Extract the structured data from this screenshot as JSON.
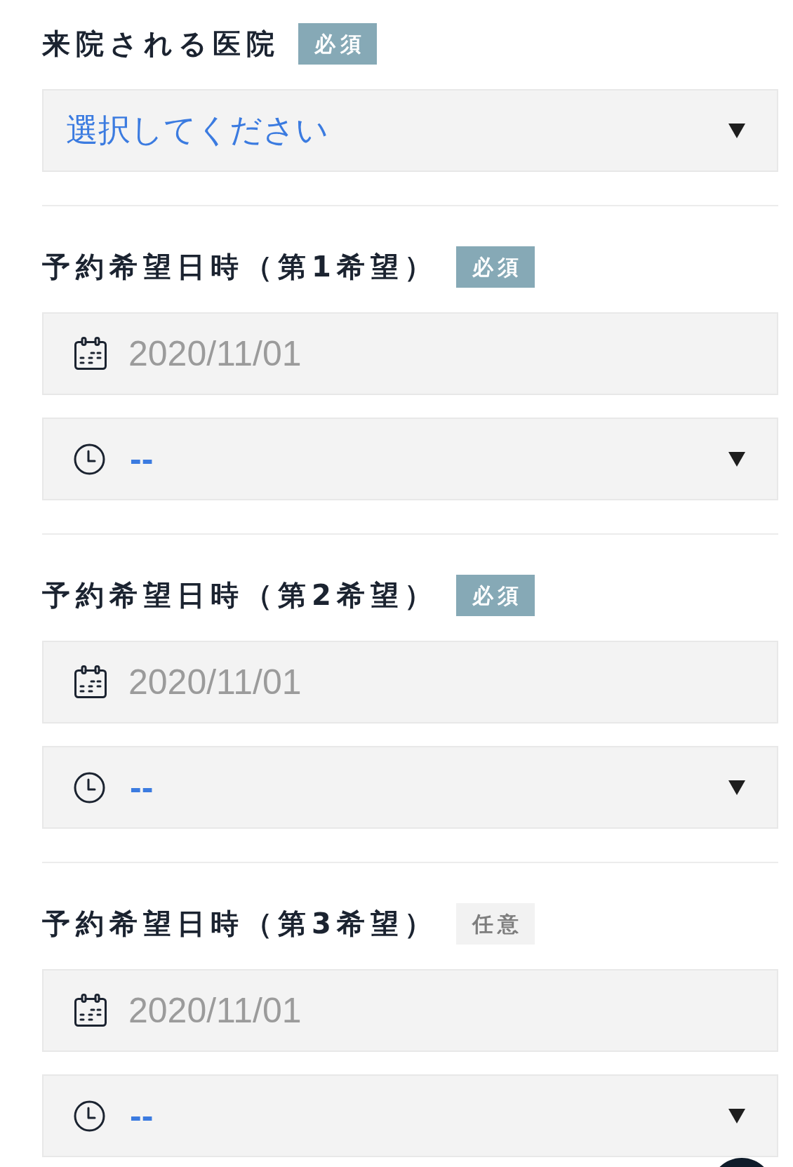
{
  "form": {
    "fields": [
      {
        "kind": "select",
        "label": "来院される医院",
        "badge": {
          "kind": "required",
          "text": "必須"
        },
        "select": {
          "value": "選択してください"
        }
      },
      {
        "kind": "datetime",
        "label": "予約希望日時（第1希望）",
        "badge": {
          "kind": "required",
          "text": "必須"
        },
        "date": {
          "placeholder": "2020/11/01"
        },
        "time": {
          "value": "--"
        }
      },
      {
        "kind": "datetime",
        "label": "予約希望日時（第2希望）",
        "badge": {
          "kind": "required",
          "text": "必須"
        },
        "date": {
          "placeholder": "2020/11/01"
        },
        "time": {
          "value": "--"
        }
      },
      {
        "kind": "datetime",
        "label": "予約希望日時（第3希望）",
        "badge": {
          "kind": "optional",
          "text": "任意"
        },
        "date": {
          "placeholder": "2020/11/01"
        },
        "time": {
          "value": "--"
        }
      }
    ]
  }
}
